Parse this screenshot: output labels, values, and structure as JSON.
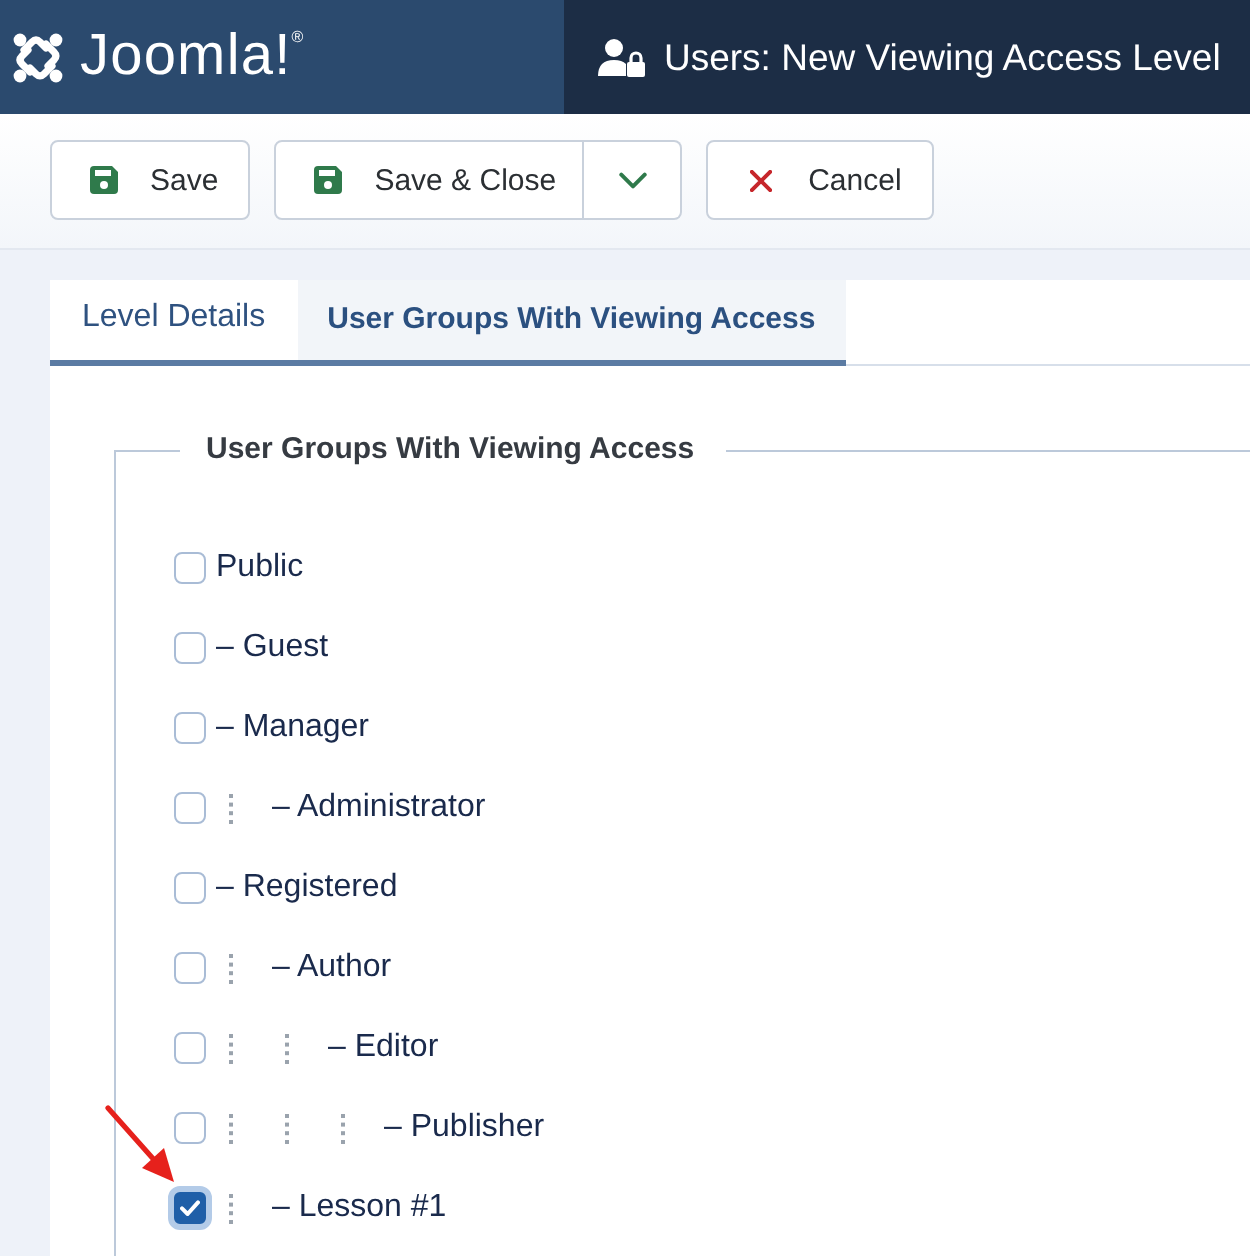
{
  "header": {
    "logo": "Joomla!$^{®}$",
    "title": "Users: New Viewing Access Level"
  },
  "toolbar": {
    "buttons": [
      {
        "kind": "save",
        "label": "Save",
        "dropdown": false
      },
      {
        "kind": "save-close",
        "label": "Save & Close",
        "dropdown": true
      },
      {
        "kind": "cancel",
        "label": "Cancel",
        "dropdown": false
      }
    ]
  },
  "tabs": [
    {
      "label": "Level Details",
      "selected": false
    },
    {
      "label": "User Groups With Viewing Access",
      "selected": true
    }
  ],
  "fieldset": {
    "legend": "User Groups With Viewing Access",
    "groups": [
      {
        "label": "Public",
        "checked": false,
        "children": [
          {
            "label": "– Guest",
            "checked": false
          },
          {
            "label": "– Manager",
            "checked": false,
            "children": [
              {
                "label": "– Administrator",
                "checked": false
              }
            ]
          },
          {
            "label": "– Registered",
            "checked": false,
            "children": [
              {
                "label": "– Author",
                "checked": false,
                "children": [
                  {
                    "label": "– Editor",
                    "checked": false,
                    "children": [
                      {
                        "label": "– Publisher",
                        "checked": false
                      }
                    ]
                  }
                ]
              },
              {
                "label": "– Lesson #1",
                "checked": true
              }
            ]
          }
        ]
      }
    ]
  }
}
